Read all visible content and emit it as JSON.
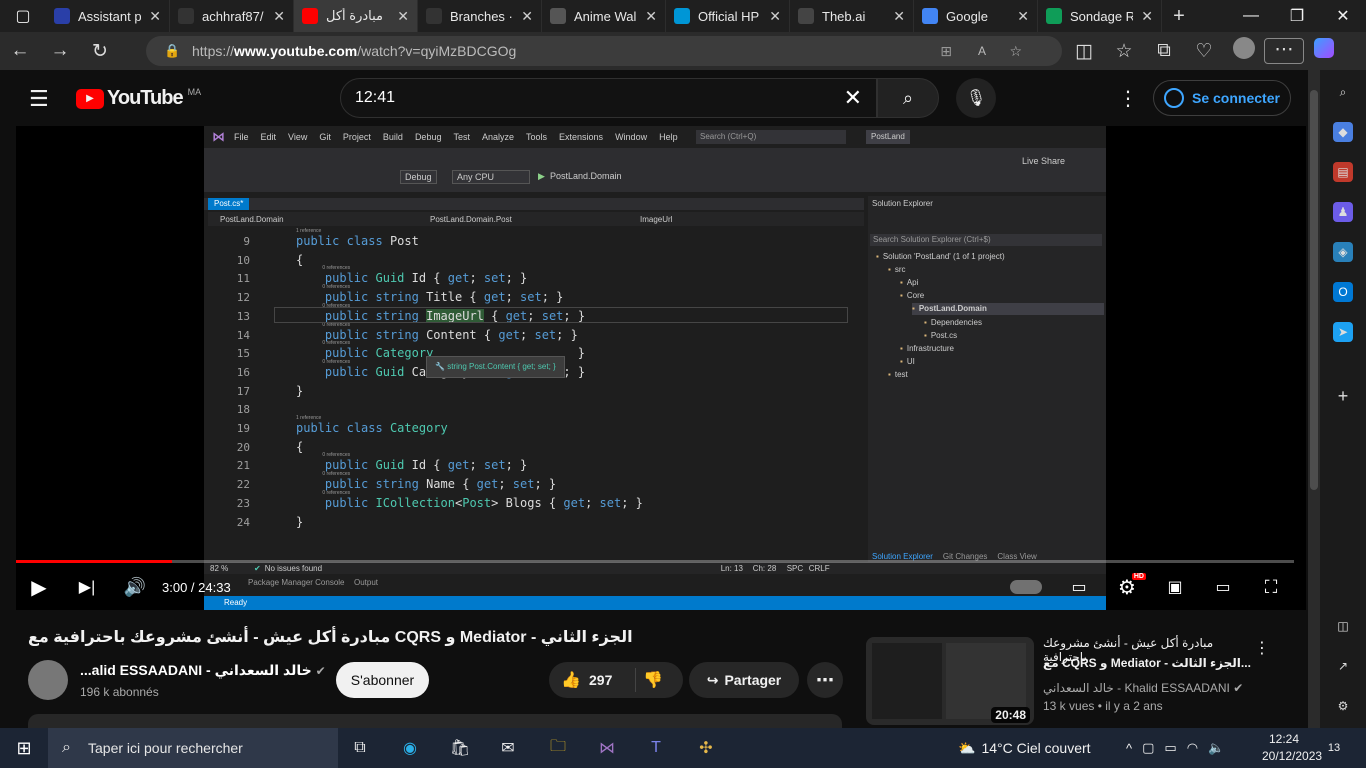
{
  "browser": {
    "tabs": [
      {
        "label": "Assistant p",
        "icon": "assistant-icon",
        "color": "#2a3fa8"
      },
      {
        "label": "achhraf87/",
        "icon": "github-icon",
        "color": "#333"
      },
      {
        "label": "مبادرة أكل",
        "icon": "youtube-icon",
        "color": "#ff0000",
        "active": true
      },
      {
        "label": "Branches ·",
        "icon": "github-icon",
        "color": "#333"
      },
      {
        "label": "Anime Wal",
        "icon": "wallpaper-icon",
        "color": "#555"
      },
      {
        "label": "Official HP",
        "icon": "hp-icon",
        "color": "#0096d6"
      },
      {
        "label": "Theb.ai",
        "icon": "theb-icon",
        "color": "#444"
      },
      {
        "label": "Google",
        "icon": "google-icon",
        "color": "#4285f4"
      },
      {
        "label": "Sondage R",
        "icon": "sheets-icon",
        "color": "#0f9d58"
      }
    ],
    "url_prefix": "https://",
    "url_host": "www.youtube.com",
    "url_path": "/watch?v=qyiMzBDCGOg"
  },
  "youtube": {
    "logo_text": "YouTube",
    "region": "MA",
    "search_value": "12:41",
    "signin_label": "Se connecter"
  },
  "vs": {
    "menu": [
      "File",
      "Edit",
      "View",
      "Git",
      "Project",
      "Build",
      "Debug",
      "Test",
      "Analyze",
      "Tools",
      "Extensions",
      "Window",
      "Help"
    ],
    "search_placeholder": "Search (Ctrl+Q)",
    "solution_badge": "PostLand",
    "live_share": "Live Share",
    "config": "Debug",
    "platform": "Any CPU",
    "run_target": "PostLand.Domain",
    "doc_tab": "Post.cs*",
    "nav": [
      "PostLand.Domain",
      "PostLand.Domain.Post",
      "ImageUrl"
    ],
    "code_lines": [
      {
        "n": "9",
        "ref": "1 reference",
        "text": "public class Post"
      },
      {
        "n": "10",
        "ref": "",
        "text": "{"
      },
      {
        "n": "11",
        "ref": "0 references",
        "text": "    public Guid Id { get; set; }"
      },
      {
        "n": "12",
        "ref": "0 references",
        "text": "    public string Title { get; set; }"
      },
      {
        "n": "13",
        "ref": "0 references",
        "text": "    public string ImageUrl { get; set; }"
      },
      {
        "n": "14",
        "ref": "0 references",
        "text": "    public string Content { get; set; }"
      },
      {
        "n": "15",
        "ref": "0 references",
        "text": "    public Category                    }"
      },
      {
        "n": "16",
        "ref": "0 references",
        "text": "    public Guid CategoryId { get; set; }"
      },
      {
        "n": "17",
        "ref": "",
        "text": "}"
      },
      {
        "n": "18",
        "ref": "",
        "text": ""
      },
      {
        "n": "19",
        "ref": "1 reference",
        "text": "public class Category"
      },
      {
        "n": "20",
        "ref": "",
        "text": "{"
      },
      {
        "n": "21",
        "ref": "0 references",
        "text": "    public Guid Id { get; set; }"
      },
      {
        "n": "22",
        "ref": "0 references",
        "text": "    public string Name { get; set; }"
      },
      {
        "n": "23",
        "ref": "0 references",
        "text": "    public ICollection<Post> Blogs { get; set; }"
      },
      {
        "n": "24",
        "ref": "",
        "text": "}"
      }
    ],
    "tooltip": "string Post.Content { get; set; }",
    "solution_explorer": {
      "title": "Solution Explorer",
      "search": "Search Solution Explorer (Ctrl+$)",
      "items": [
        {
          "label": "Solution 'PostLand' (1 of 1 project)",
          "indent": 0
        },
        {
          "label": "src",
          "indent": 1
        },
        {
          "label": "Api",
          "indent": 2
        },
        {
          "label": "Core",
          "indent": 2
        },
        {
          "label": "PostLand.Domain",
          "indent": 3,
          "selected": true
        },
        {
          "label": "Dependencies",
          "indent": 4
        },
        {
          "label": "Post.cs",
          "indent": 4
        },
        {
          "label": "Infrastructure",
          "indent": 2
        },
        {
          "label": "UI",
          "indent": 2
        },
        {
          "label": "test",
          "indent": 1
        }
      ],
      "tabs": [
        "Solution Explorer",
        "Git Changes",
        "Class View"
      ]
    },
    "zoom": "82 %",
    "issues": "No issues found",
    "ln": "Ln: 13",
    "ch": "Ch: 28",
    "spc": "SPC",
    "crlf": "CRLF",
    "bottom_tabs": [
      "Package Manager Console",
      "Output"
    ],
    "ready": "Ready"
  },
  "player": {
    "time": "3:00 / 24:33",
    "progress": 0.122,
    "hd": "HD"
  },
  "video": {
    "title": "الجزء الثاني - Mediator و CQRS مبادرة أكل عيش - أنشئ مشروعك باحترافية مع",
    "channel": "...alid ESSAADANI - خالد السعداني",
    "subscribers": "196 k abonnés",
    "subscribe_label": "S'abonner",
    "likes": "297",
    "share_label": "Partager"
  },
  "related": {
    "title_line1": "مبادرة أكل عيش - أنشئ مشروعك باحترافية",
    "title_line2": "...الجزء الثالث - Mediator و CQRS مع",
    "channel": "خالد السعداني - Khalid ESSAADANI",
    "views": "13 k vues",
    "age": "il y a 2 ans",
    "duration": "20:48"
  },
  "taskbar": {
    "search_placeholder": "Taper ici pour rechercher",
    "weather": "14°C  Ciel couvert",
    "time": "12:24",
    "date": "20/12/2023",
    "notifications": "13"
  }
}
